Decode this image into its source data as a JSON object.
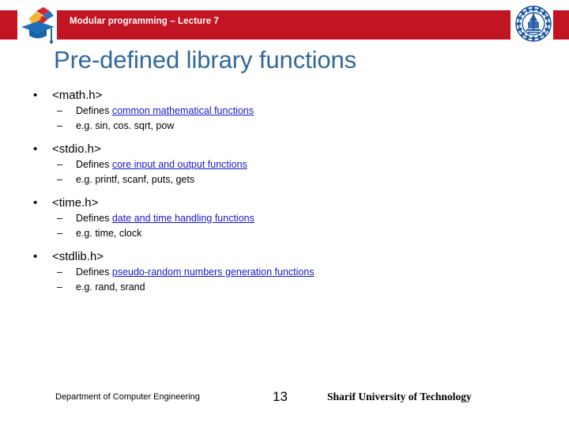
{
  "header": {
    "title": "Modular programming – Lecture 7",
    "bar_color": "#C11524",
    "left_logo_name": "graduation-cap-logo",
    "right_logo_name": "sharif-university-emblem"
  },
  "slide": {
    "title": "Pre-defined library functions",
    "title_color": "#31689B",
    "link_color": "#1818C8"
  },
  "content": {
    "groups": [
      {
        "header_name": "math-h",
        "header": "<math.h>",
        "defines_prefix": "Defines ",
        "defines_link": "common mathematical functions",
        "example": "e.g. sin, cos. sqrt, pow"
      },
      {
        "header_name": "stdio-h",
        "header": "<stdio.h>",
        "defines_prefix": "Defines ",
        "defines_link": "core input and output functions",
        "example": "e.g. printf, scanf, puts, gets"
      },
      {
        "header_name": "time-h",
        "header": "<time.h>",
        "defines_prefix": "Defines ",
        "defines_link": "date and time handling functions",
        "example": "e.g. time, clock"
      },
      {
        "header_name": "stdlib-h",
        "header": "<stdlib.h>",
        "defines_prefix": "Defines ",
        "defines_link": "pseudo-random numbers generation functions",
        "example": "e.g. rand, srand"
      }
    ],
    "bullet_glyph": "•",
    "sub_glyph": "–"
  },
  "footer": {
    "department": "Department of Computer Engineering",
    "slide_number": "13",
    "university": "Sharif University of Technology"
  }
}
